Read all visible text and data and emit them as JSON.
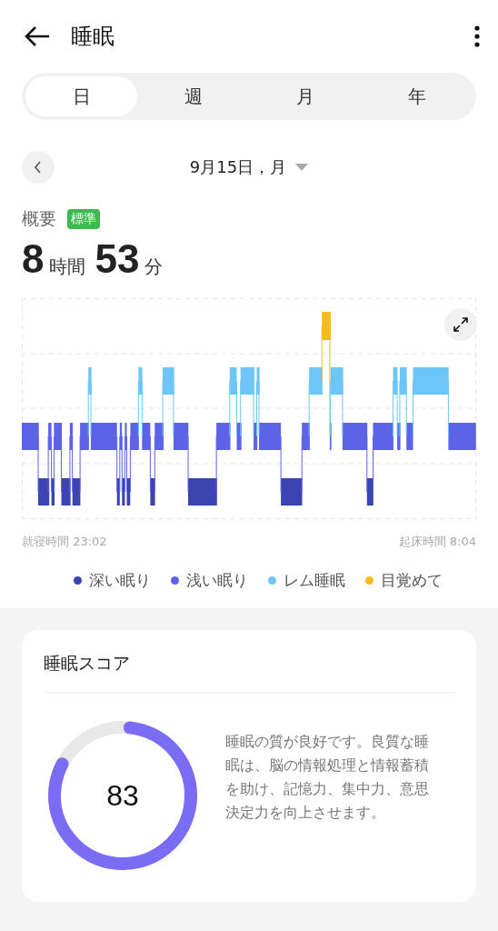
{
  "header": {
    "title": "睡眠"
  },
  "tabs": [
    {
      "label": "日",
      "selected": true
    },
    {
      "label": "週",
      "selected": false
    },
    {
      "label": "月",
      "selected": false
    },
    {
      "label": "年",
      "selected": false
    }
  ],
  "date": {
    "label": "9月15日，月"
  },
  "summary": {
    "label": "概要",
    "badge": "標準",
    "hours": "8",
    "hours_unit": "時間",
    "minutes": "53",
    "minutes_unit": "分"
  },
  "chart": {
    "bedtime": "就寝時間 23:02",
    "wake_time": "起床時間 8:04"
  },
  "legend": [
    {
      "label": "深い眠り",
      "color": "#3b44b0"
    },
    {
      "label": "浅い眠り",
      "color": "#5c63e6"
    },
    {
      "label": "レム睡眠",
      "color": "#6ec5f8"
    },
    {
      "label": "目覚めて",
      "color": "#f8bb17"
    }
  ],
  "score_card": {
    "title": "睡眠スコア",
    "score": "83",
    "level": 0.83,
    "description": "睡眠の質が良好です。良質な睡眠は、脳の情報処理と情報蓄積を助け、記憶力、集中力、意思決定力を向上させます。"
  }
}
